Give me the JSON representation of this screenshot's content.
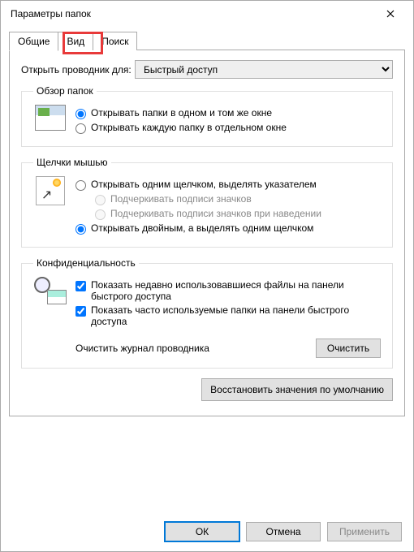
{
  "window": {
    "title": "Параметры папок"
  },
  "tabs": {
    "general": "Общие",
    "view": "Вид",
    "search": "Поиск"
  },
  "openRow": {
    "label": "Открыть проводник для:",
    "value": "Быстрый доступ"
  },
  "browse": {
    "legend": "Обзор папок",
    "opt1": "Открывать папки в одном и том же окне",
    "opt2": "Открывать каждую папку в отдельном окне"
  },
  "clicks": {
    "legend": "Щелчки мышью",
    "opt1": "Открывать одним щелчком, выделять указателем",
    "sub1": "Подчеркивать подписи значков",
    "sub2": "Подчеркивать подписи значков при наведении",
    "opt2": "Открывать двойным, а выделять одним щелчком"
  },
  "privacy": {
    "legend": "Конфиденциальность",
    "chk1": "Показать недавно использовавшиеся файлы на панели быстрого доступа",
    "chk2": "Показать часто используемые папки на панели быстрого доступа",
    "clearLabel": "Очистить журнал проводника",
    "clearBtn": "Очистить"
  },
  "restore": "Восстановить значения по умолчанию",
  "buttons": {
    "ok": "ОК",
    "cancel": "Отмена",
    "apply": "Применить"
  }
}
